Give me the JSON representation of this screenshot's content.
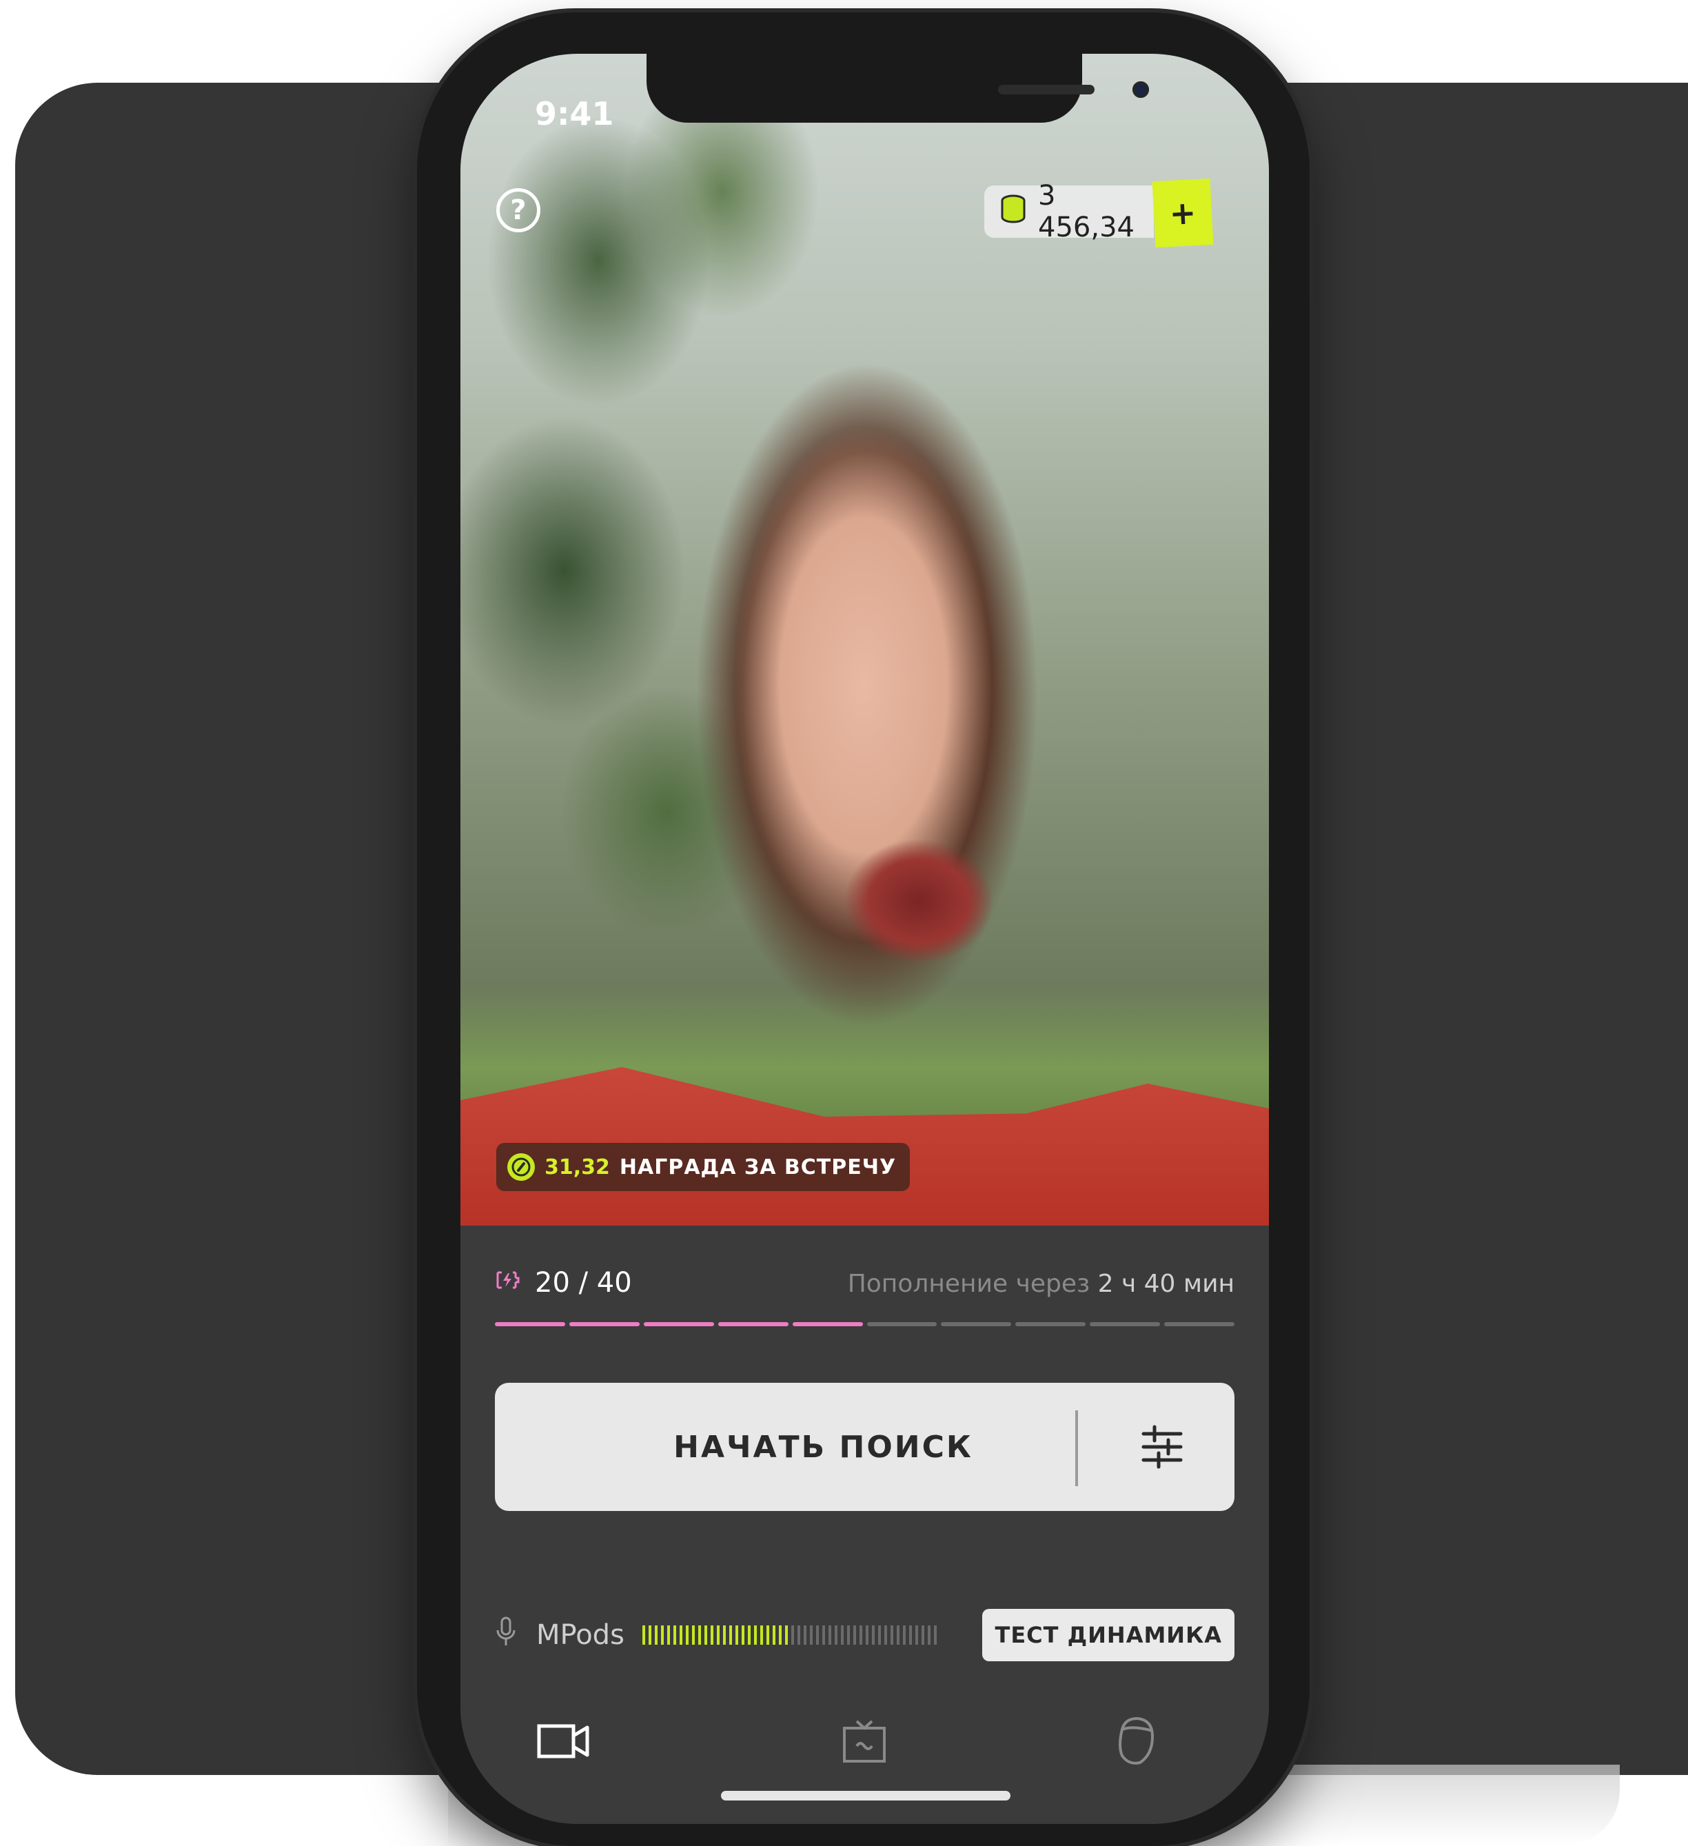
{
  "status": {
    "time": "9:41"
  },
  "header": {
    "help_label": "?",
    "balance": "3 456,34",
    "add_label": "+"
  },
  "reward": {
    "amount": "31,32",
    "label": "НАГРАДА ЗА ВСТРЕЧУ"
  },
  "energy": {
    "value": "20 / 40",
    "refill_prefix": "Пополнение через",
    "refill_time": "2 ч 40 мин",
    "segments_total": 10,
    "segments_filled": 5
  },
  "search": {
    "label": "НАЧАТЬ ПОИСК"
  },
  "audio": {
    "device": "MPods",
    "level": 0.5,
    "test_label": "ТЕСТ ДИНАМИКА"
  },
  "tabs": [
    {
      "icon": "video-camera-icon",
      "active": true
    },
    {
      "icon": "tv-icon",
      "active": false
    },
    {
      "icon": "profile-head-icon",
      "active": false
    }
  ],
  "colors": {
    "accent_lime": "#d8f222",
    "energy_pink": "#f07cc4",
    "panel_bg": "#3b3b3b"
  }
}
